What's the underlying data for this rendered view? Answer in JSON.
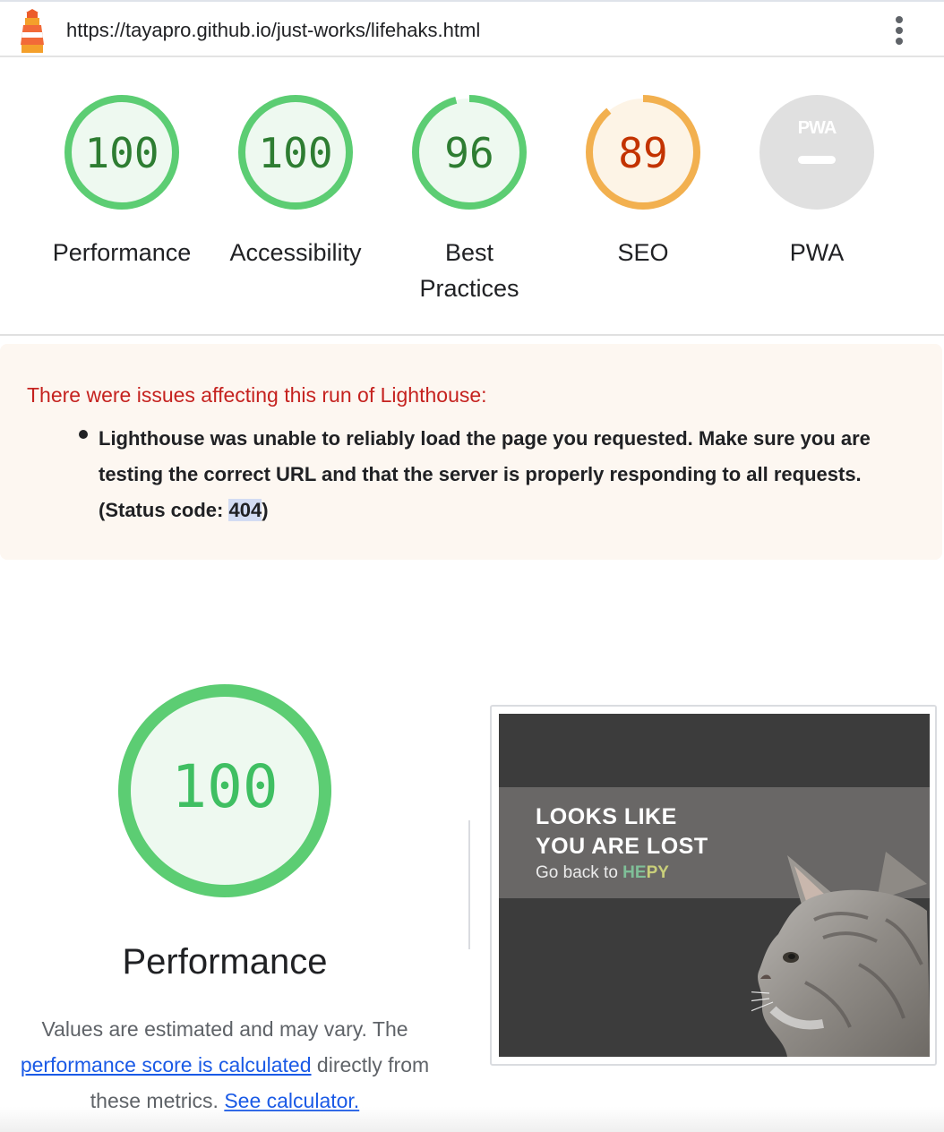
{
  "header": {
    "url": "https://tayapro.github.io/just-works/lifehaks.html"
  },
  "gauges": [
    {
      "score": "100",
      "label": "Performance",
      "value": 100,
      "status": "pass"
    },
    {
      "score": "100",
      "label": "Accessibility",
      "value": 100,
      "status": "pass"
    },
    {
      "score": "96",
      "label": "Best Practices",
      "value": 96,
      "status": "pass"
    },
    {
      "score": "89",
      "label": "SEO",
      "value": 89,
      "status": "average"
    },
    {
      "score": "",
      "label": "PWA",
      "value": null,
      "status": "na",
      "badge_text": "PWA"
    }
  ],
  "warning": {
    "title": "There were issues affecting this run of Lighthouse:",
    "item_before": "Lighthouse was unable to reliably load the page you requested. Make sure you are testing the correct URL and that the server is properly responding to all requests. (Status code: ",
    "item_code": "404",
    "item_after": ")"
  },
  "performance": {
    "score": "100",
    "value": 100,
    "title": "Performance",
    "desc_part1": "Values are estimated and may vary. The",
    "link1": "performance score is calculated",
    "desc_part2": " directly from these metrics. ",
    "link2": "See calculator."
  },
  "screenshot": {
    "line1": "LOOKS LIKE",
    "line2": "YOU ARE LOST",
    "goback": "Go back to ",
    "brand_h": "HE",
    "brand_rest": "PY"
  },
  "colors": {
    "pass": "#0cce6b",
    "pass_stroke": "#5ccd73",
    "pass_text": "#2e7d32",
    "average": "#ffa400",
    "average_stroke": "#f2b04f",
    "average_text": "#c33300",
    "na": "#e0e0e0",
    "warning_bg": "#fdf7f1",
    "warning_title": "#c5221f",
    "link": "#1a5ae6"
  },
  "icons": [
    "lighthouse-logo-icon",
    "kebab-menu-icon",
    "pwa-dash-icon"
  ]
}
